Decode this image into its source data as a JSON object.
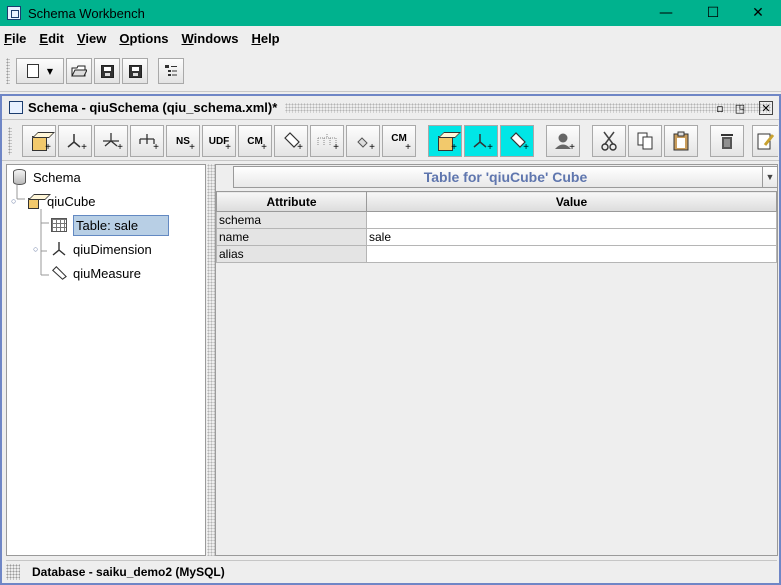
{
  "window": {
    "title": "Schema Workbench"
  },
  "menu": [
    {
      "u": "F",
      "rest": "ile"
    },
    {
      "u": "E",
      "rest": "dit"
    },
    {
      "u": "V",
      "rest": "iew"
    },
    {
      "u": "O",
      "rest": "ptions"
    },
    {
      "u": "W",
      "rest": "indows"
    },
    {
      "u": "H",
      "rest": "elp"
    }
  ],
  "main_toolbar": [
    "new-document-icon",
    "open-folder-icon",
    "save-icon",
    "save-as-icon",
    "tree-view-icon"
  ],
  "frame": {
    "title": "Schema - qiuSchema (qiu_schema.xml)*"
  },
  "schema_toolbar": {
    "ns": "NS",
    "udf": "UDF",
    "cm": "CM",
    "cm2": "CM"
  },
  "tree": {
    "root": "Schema",
    "cube": "qiuCube",
    "table": "Table: sale",
    "dimension": "qiuDimension",
    "measure": "qiuMeasure"
  },
  "panel": {
    "title": "Table for 'qiuCube' Cube",
    "col_attribute": "Attribute",
    "col_value": "Value",
    "rows": [
      {
        "attr": "schema",
        "value": ""
      },
      {
        "attr": "name",
        "value": "sale"
      },
      {
        "attr": "alias",
        "value": ""
      }
    ]
  },
  "status": "Database - saiku_demo2 (MySQL)"
}
